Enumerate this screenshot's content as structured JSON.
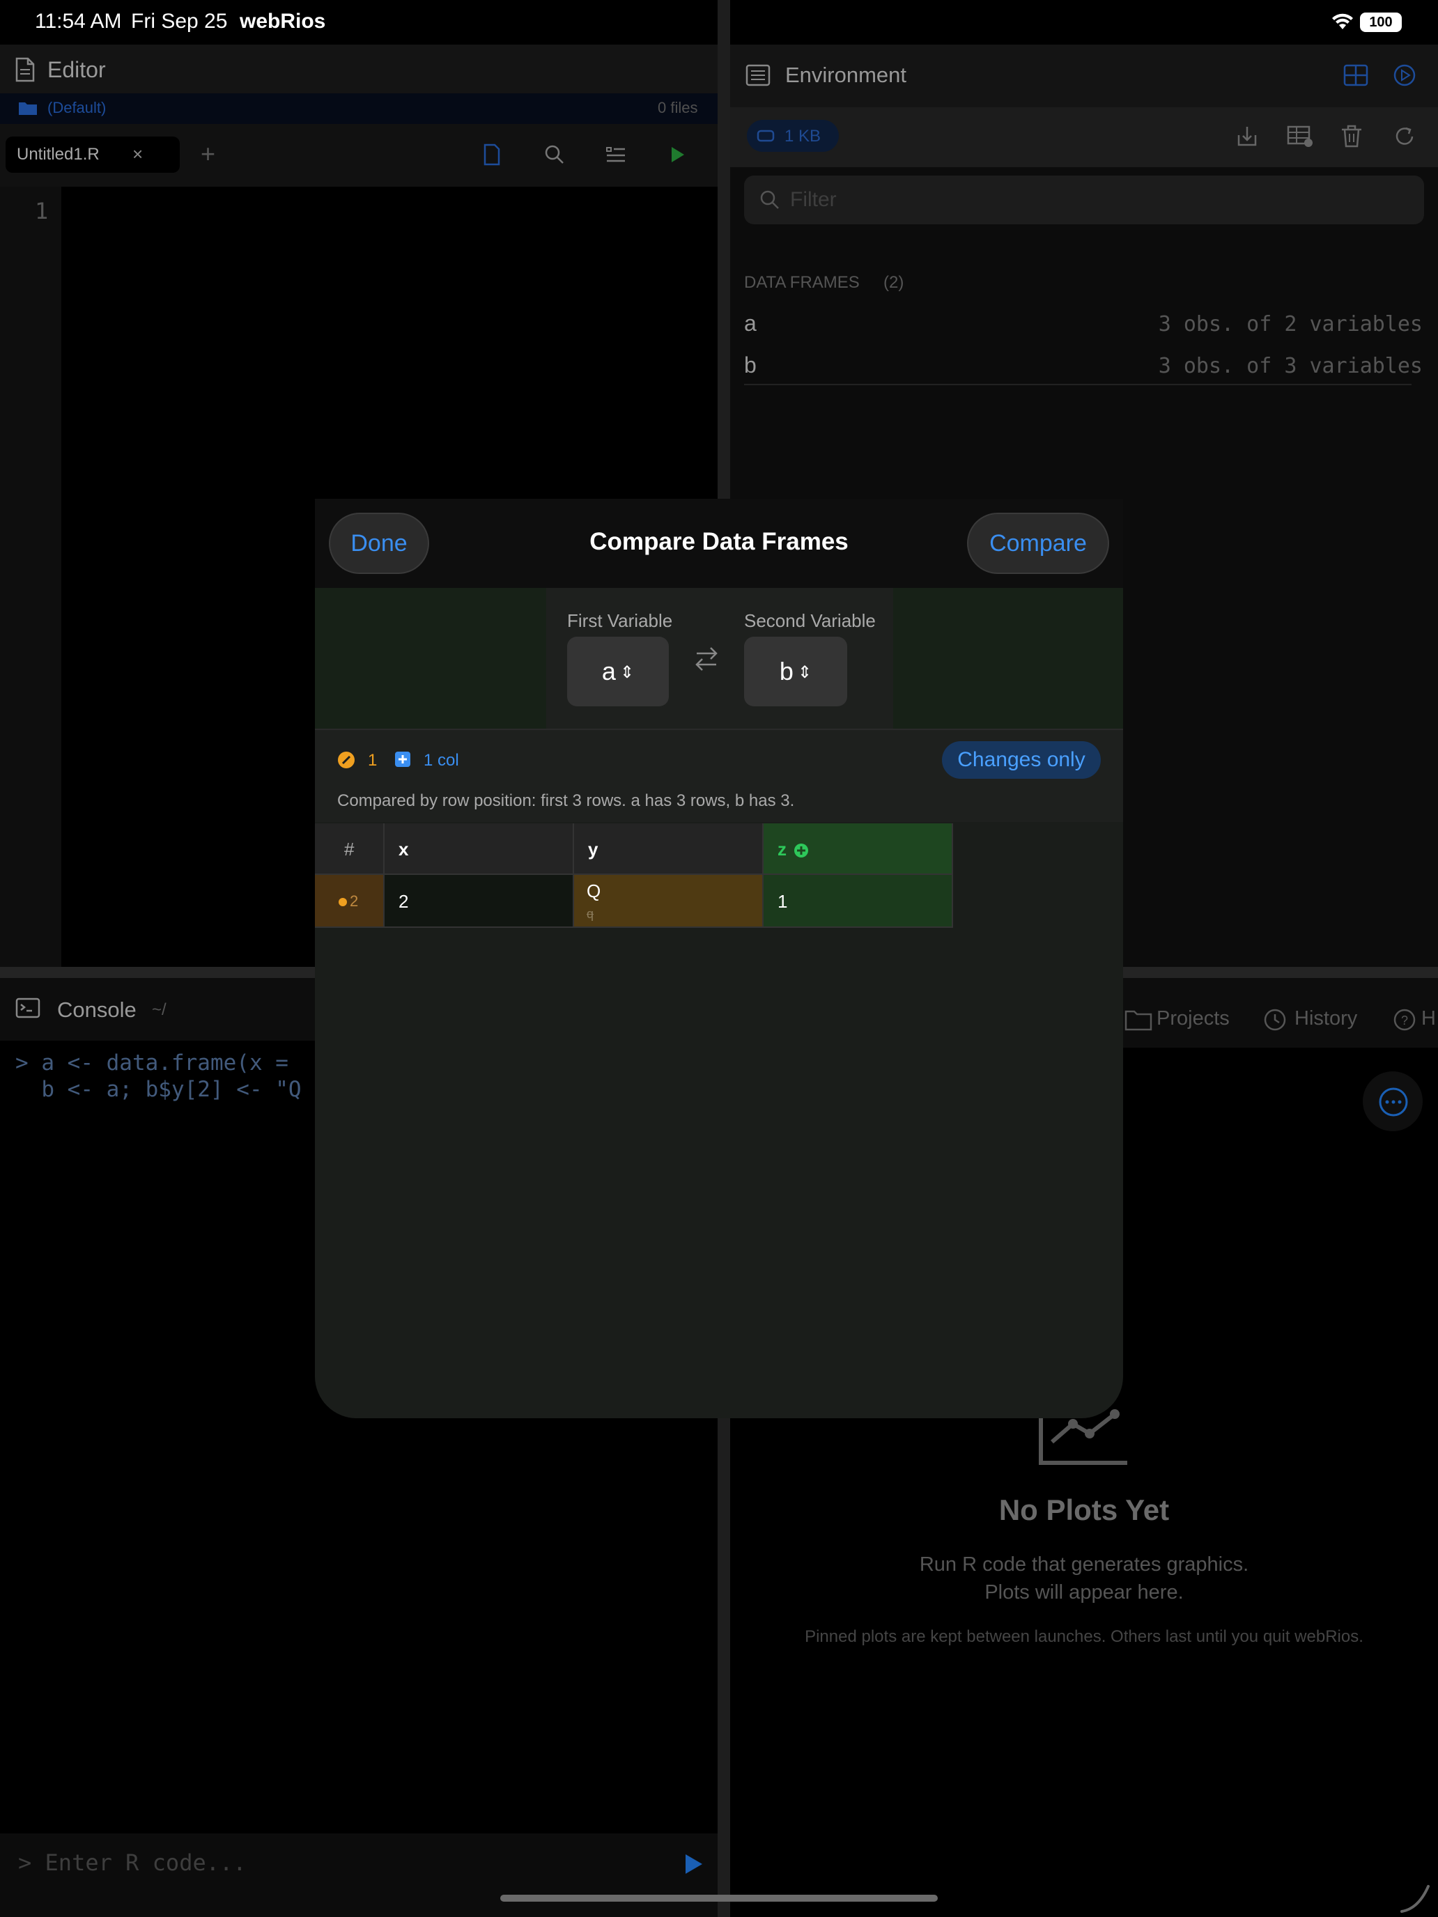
{
  "status_bar": {
    "time": "11:54 AM",
    "date": "Fri Sep 25",
    "app": "webRios",
    "battery": "100"
  },
  "editor": {
    "title": "Editor",
    "folder": "(Default)",
    "file_count": "0 files",
    "tab_name": "Untitled1.R",
    "tab_close": "×",
    "tab_add": "+",
    "line_number": "1"
  },
  "console": {
    "title": "Console",
    "path": "~/",
    "lines": [
      "> a <- data.frame(x =",
      "  b <- a; b$y[2] <- \"Q"
    ],
    "placeholder": "> Enter R code..."
  },
  "environment": {
    "title": "Environment",
    "memory": "1 KB",
    "filter_placeholder": "Filter",
    "section_label": "DATA FRAMES",
    "section_count": "(2)",
    "rows": [
      {
        "name": "a",
        "desc": "3 obs. of 2 variables"
      },
      {
        "name": "b",
        "desc": "3 obs. of 3 variables"
      }
    ]
  },
  "plots": {
    "tabs": [
      "Projects",
      "History",
      "H"
    ],
    "empty_title": "No Plots Yet",
    "empty_sub1": "Run R code that generates graphics.",
    "empty_sub2": "Plots will appear here.",
    "empty_note": "Pinned plots are kept between launches. Others last until you quit webRios."
  },
  "modal": {
    "done_label": "Done",
    "title": "Compare Data Frames",
    "compare_label": "Compare",
    "first_var_label": "First Variable",
    "first_var_value": "a",
    "second_var_label": "Second Variable",
    "second_var_value": "b",
    "changed_count": "1",
    "added_cols": "1 col",
    "changes_only_label": "Changes only",
    "note": "Compared by row position: first 3 rows. a has 3 rows, b has 3.",
    "table": {
      "headers": [
        "#",
        "x",
        "y",
        "z"
      ],
      "row": {
        "index": "2",
        "x": "2",
        "y_new": "Q",
        "y_old": "q",
        "z": "1"
      }
    }
  },
  "colors": {
    "accent": "#3a8ef0",
    "changed": "#f0a020",
    "added": "#2ec85a"
  }
}
